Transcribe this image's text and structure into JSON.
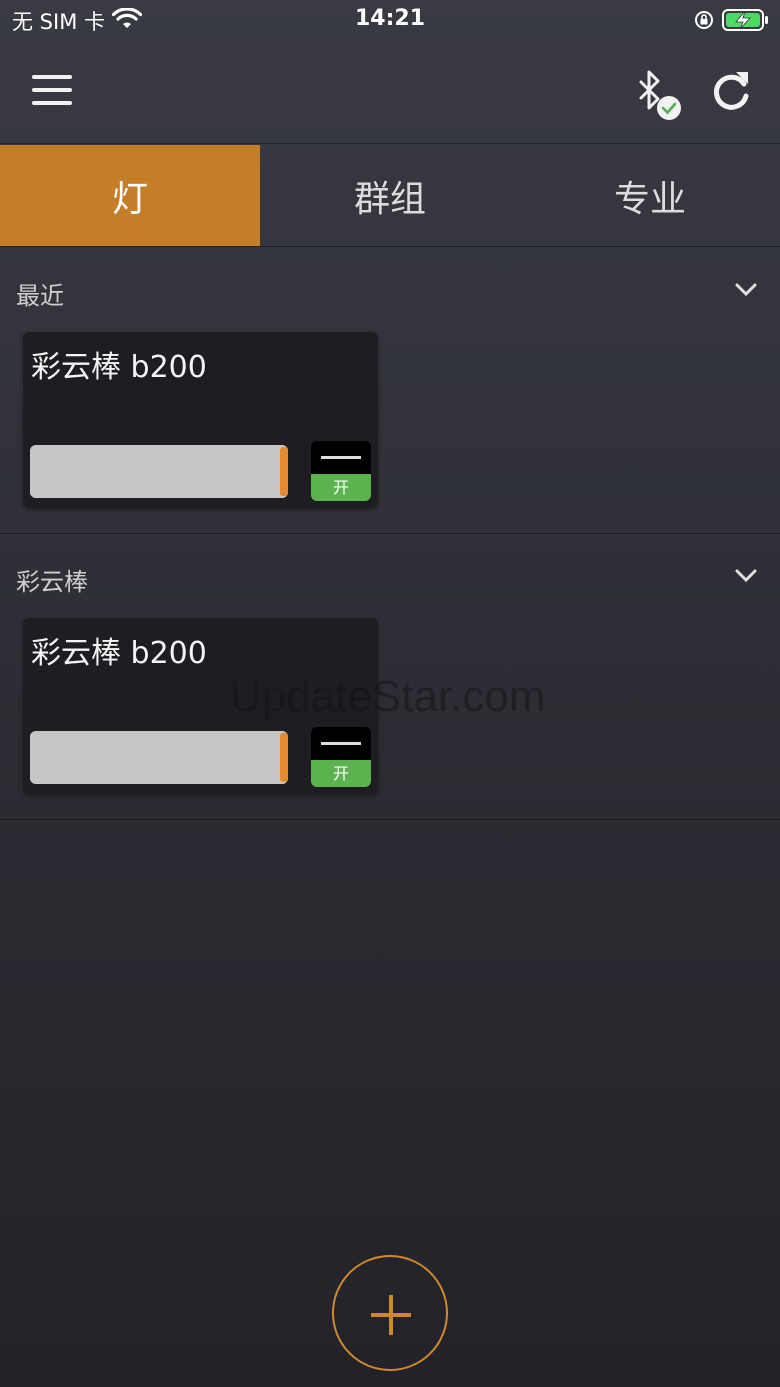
{
  "status_bar": {
    "carrier": "无 SIM 卡",
    "time": "14:21",
    "battery_color": "#4cd964"
  },
  "navbar": {
    "menu_icon": "hamburger-menu-icon",
    "bluetooth_icon": "bluetooth-connected-icon",
    "refresh_icon": "refresh-icon"
  },
  "tabs": [
    {
      "label": "灯",
      "active": true
    },
    {
      "label": "群组",
      "active": false
    },
    {
      "label": "专业",
      "active": false
    }
  ],
  "sections": [
    {
      "title": "最近",
      "devices": [
        {
          "name": "彩云棒 b200",
          "brightness": 1.0,
          "toggle_label": "开"
        }
      ]
    },
    {
      "title": "彩云棒",
      "devices": [
        {
          "name": "彩云棒 b200",
          "brightness": 1.0,
          "toggle_label": "开"
        }
      ]
    }
  ],
  "watermark": "UpdateStar.com",
  "colors": {
    "accent": "#c47d28",
    "toggle_on": "#5cb24f",
    "slider_handle": "#e58a2f"
  },
  "fab_icon": "add-icon"
}
